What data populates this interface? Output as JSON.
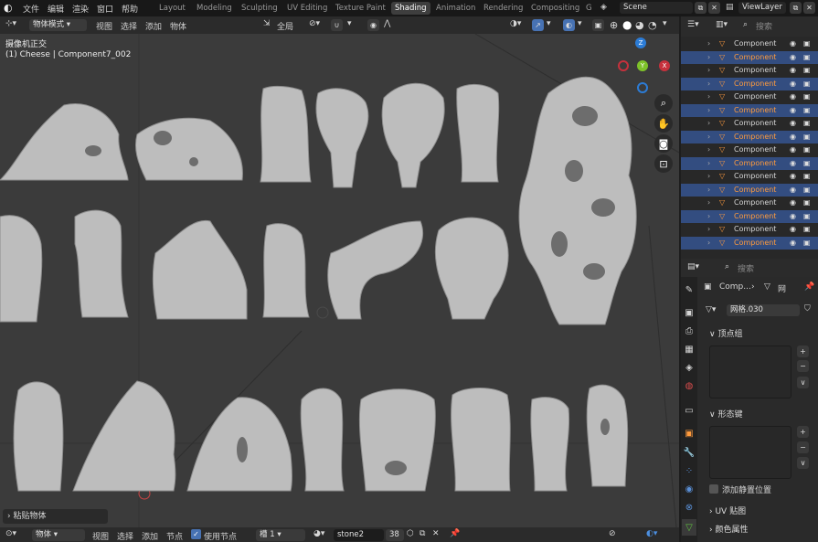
{
  "menu": {
    "items": [
      "文件",
      "编辑",
      "渲染",
      "窗口",
      "帮助"
    ]
  },
  "workspaces": {
    "tabs": [
      "Layout",
      "Modeling",
      "Sculpting",
      "UV Editing",
      "Texture Paint",
      "Shading",
      "Animation",
      "Rendering",
      "Compositing",
      "G"
    ],
    "active": "Shading"
  },
  "scene": {
    "name": "Scene",
    "view_layer": "ViewLayer"
  },
  "viewport_header": {
    "mode": "物体模式",
    "menus": [
      "视图",
      "选择",
      "添加",
      "物体"
    ],
    "transform_orientation": "全局"
  },
  "viewport": {
    "title": "摄像机正交",
    "object_info": "(1) Cheese | Component7_002",
    "redo_panel": "粘贴物体"
  },
  "gizmo": {
    "x": "X",
    "y": "Y",
    "z": "Z"
  },
  "outliner": {
    "search_placeholder": "搜索",
    "item_label": "Component",
    "rows": [
      {
        "label": "Component",
        "selected": false
      },
      {
        "label": "Component",
        "selected": true
      },
      {
        "label": "Component",
        "selected": false
      },
      {
        "label": "Component",
        "selected": true
      },
      {
        "label": "Component",
        "selected": false
      },
      {
        "label": "Component",
        "selected": true
      },
      {
        "label": "Component",
        "selected": false
      },
      {
        "label": "Component",
        "selected": true
      },
      {
        "label": "Component",
        "selected": false
      },
      {
        "label": "Component",
        "selected": true
      },
      {
        "label": "Component",
        "selected": false
      },
      {
        "label": "Component",
        "selected": true
      },
      {
        "label": "Component",
        "selected": false
      },
      {
        "label": "Component",
        "selected": true
      },
      {
        "label": "Component",
        "selected": false
      },
      {
        "label": "Component",
        "selected": true
      }
    ]
  },
  "properties": {
    "search_placeholder": "搜索",
    "breadcrumb_object": "Comp...",
    "breadcrumb_data": "网",
    "mesh_name": "网格.030",
    "vertex_groups": "顶点组",
    "shape_keys": "形态键",
    "add_rest_position": "添加静置位置",
    "uv_maps": "UV 贴图",
    "color_attributes": "颜色属性"
  },
  "node_header": {
    "mode": "物体",
    "menus": [
      "视图",
      "选择",
      "添加",
      "节点"
    ],
    "use_nodes": "使用节点",
    "slot": "槽 1",
    "material": "stone2",
    "users": "38"
  },
  "colors": {
    "accent": "#ff9b3d",
    "selected_row": "#334d80",
    "gizmo_x": "#c6313c",
    "gizmo_y": "#7ec22a",
    "gizmo_z": "#2c7cd6"
  }
}
